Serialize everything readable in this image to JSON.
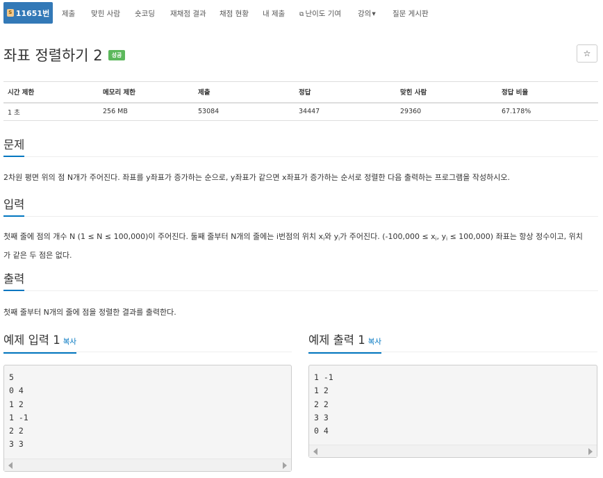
{
  "nav": {
    "problem_badge": "11651번",
    "tier_icon_text": "S",
    "items": [
      "제출",
      "맞힌 사람",
      "숏코딩",
      "재채점 결과",
      "채점 현황",
      "내 제출",
      "난이도 기여",
      "강의",
      "질문 게시판"
    ],
    "icons": {
      "tier": "silver-tier-icon",
      "external": "external-link-icon",
      "caret": "caret-down-icon"
    }
  },
  "problem": {
    "title": "좌표 정렬하기 2",
    "status_badge": "성공",
    "star": "☆"
  },
  "info_table": {
    "headers": [
      "시간 제한",
      "메모리 제한",
      "제출",
      "정답",
      "맞힌 사람",
      "정답 비율"
    ],
    "row": [
      "1 초",
      "256 MB",
      "53084",
      "34447",
      "29360",
      "67.178%"
    ]
  },
  "sections": {
    "description": {
      "title": "문제",
      "text": "2차원 평면 위의 점 N개가 주어진다. 좌표를 y좌표가 증가하는 순으로, y좌표가 같으면 x좌표가 증가하는 순서로 정렬한 다음 출력하는 프로그램을 작성하시오."
    },
    "input": {
      "title": "입력",
      "line1_a": "첫째 줄에 점의 개수 N (1 ≤ N ≤ 100,000)이 주어진다. 둘째 줄부터 N개의 줄에는 i번점의 위치 x",
      "sub_i": "i",
      "line1_b": "와 y",
      "line1_c": "가 주어진다. (-100,000 ≤ x",
      "line1_d": ", y",
      "line1_e": " ≤ 100,000) 좌표는 항상 정수이고, 위치",
      "line2": "가 같은 두 점은 없다."
    },
    "output": {
      "title": "출력",
      "text": "첫째 줄부터 N개의 줄에 점을 정렬한 결과를 출력한다."
    }
  },
  "samples": {
    "input": {
      "title": "예제 입력 1",
      "copy": "복사",
      "content": "5\n0 4\n1 2\n1 -1\n2 2\n3 3"
    },
    "output": {
      "title": "예제 출력 1",
      "copy": "복사",
      "content": "1 -1\n1 2\n2 2\n3 3\n0 4"
    }
  },
  "colors": {
    "primary": "#3379b7",
    "success": "#5cb85c",
    "link": "#0076c0"
  }
}
